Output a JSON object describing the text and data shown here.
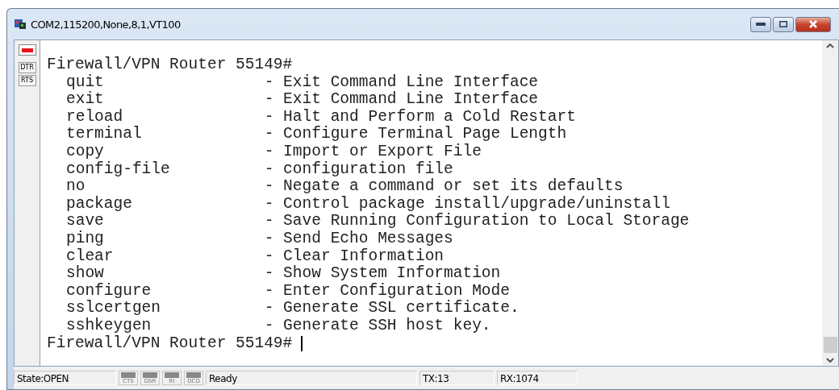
{
  "window": {
    "title": "COM2,115200,None,8,1,VT100"
  },
  "side_panel": {
    "led": {
      "on": true
    },
    "buttons": [
      {
        "label": "DTR"
      },
      {
        "label": "RTS"
      }
    ]
  },
  "terminal": {
    "prompt": "Firewall/VPN Router 55149#",
    "commands": [
      {
        "command": "quit",
        "description": "- Exit Command Line Interface"
      },
      {
        "command": "exit",
        "description": "- Exit Command Line Interface"
      },
      {
        "command": "reload",
        "description": "- Halt and Perform a Cold Restart"
      },
      {
        "command": "terminal",
        "description": "- Configure Terminal Page Length"
      },
      {
        "command": "copy",
        "description": "- Import or Export File"
      },
      {
        "command": "config-file",
        "description": "- configuration file"
      },
      {
        "command": "no",
        "description": "- Negate a command or set its defaults"
      },
      {
        "command": "package",
        "description": "- Control package install/upgrade/uninstall"
      },
      {
        "command": "save",
        "description": "- Save Running Configuration to Local Storage"
      },
      {
        "command": "ping",
        "description": "- Send Echo Messages"
      },
      {
        "command": "clear",
        "description": "- Clear Information"
      },
      {
        "command": "show",
        "description": "- Show System Information"
      },
      {
        "command": "configure",
        "description": "- Enter Configuration Mode"
      },
      {
        "command": "sslcertgen",
        "description": "- Generate SSL certificate."
      },
      {
        "command": "sshkeygen",
        "description": "- Generate SSH host key."
      }
    ],
    "last_prompt": "Firewall/VPN Router 55149#"
  },
  "status_bar": {
    "state": "State:OPEN",
    "signals": [
      {
        "label": "CTS",
        "on": false
      },
      {
        "label": "DSR",
        "on": false
      },
      {
        "label": "RI",
        "on": false
      },
      {
        "label": "DCD",
        "on": false
      }
    ],
    "message": "Ready",
    "tx": "TX:13",
    "rx": "RX:1074"
  }
}
